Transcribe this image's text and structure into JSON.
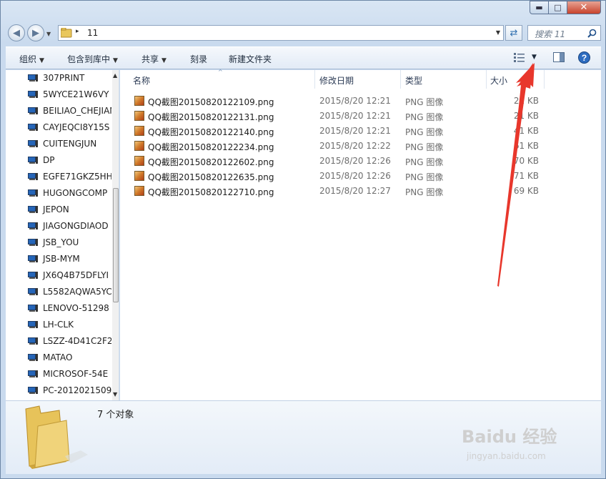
{
  "window": {
    "minimize_glyph": "▬",
    "maximize_glyph": "□",
    "close_glyph": "✕"
  },
  "address": {
    "path": "11",
    "separator": "▸"
  },
  "search": {
    "placeholder": "搜索 11"
  },
  "toolbar": {
    "organize": "组织",
    "include_in_library": "包含到库中",
    "share": "共享",
    "burn": "刻录",
    "new_folder": "新建文件夹"
  },
  "nav_pane": {
    "items": [
      "307PRINT",
      "5WYCE21W6VY",
      "BEILIAO_CHEJIAN",
      "CAYJEQCI8Y15S",
      "CUITENGJUN",
      "DP",
      "EGFE71GKZ5HH",
      "HUGONGCOMP",
      "JEPON",
      "JIAGONGDIAOD",
      "JSB_YOU",
      "JSB-MYM",
      "JX6Q4B75DFLYI",
      "L5582AQWA5YC",
      "LENOVO-51298",
      "LH-CLK",
      "LSZZ-4D41C2F2",
      "MATAO",
      "MICROSOF-54E",
      "PC-2012021509"
    ]
  },
  "columns": {
    "name": "名称",
    "date": "修改日期",
    "type": "类型",
    "size": "大小"
  },
  "files": [
    {
      "name": "QQ截图20150820122109.png",
      "date": "2015/8/20 12:21",
      "type": "PNG 图像",
      "size": "21 KB"
    },
    {
      "name": "QQ截图20150820122131.png",
      "date": "2015/8/20 12:21",
      "type": "PNG 图像",
      "size": "21 KB"
    },
    {
      "name": "QQ截图20150820122140.png",
      "date": "2015/8/20 12:21",
      "type": "PNG 图像",
      "size": "41 KB"
    },
    {
      "name": "QQ截图20150820122234.png",
      "date": "2015/8/20 12:22",
      "type": "PNG 图像",
      "size": "61 KB"
    },
    {
      "name": "QQ截图20150820122602.png",
      "date": "2015/8/20 12:26",
      "type": "PNG 图像",
      "size": "70 KB"
    },
    {
      "name": "QQ截图20150820122635.png",
      "date": "2015/8/20 12:26",
      "type": "PNG 图像",
      "size": "71 KB"
    },
    {
      "name": "QQ截图20150820122710.png",
      "date": "2015/8/20 12:27",
      "type": "PNG 图像",
      "size": "69 KB"
    }
  ],
  "details": {
    "count": "7 个对象"
  },
  "watermark": {
    "text": "Baidu 经验",
    "sub": "jingyan.baidu.com"
  },
  "colors": {
    "annotation_arrow": "#e8372c",
    "window_frame": "#c9daee"
  },
  "icons": {
    "back": "back-arrow-icon",
    "forward": "forward-arrow-icon",
    "folder": "folder-icon",
    "refresh": "refresh-icon",
    "search": "search-icon",
    "view": "view-options-icon",
    "preview": "preview-pane-icon",
    "help": "help-icon",
    "computer": "computer-icon",
    "png": "png-file-icon"
  }
}
